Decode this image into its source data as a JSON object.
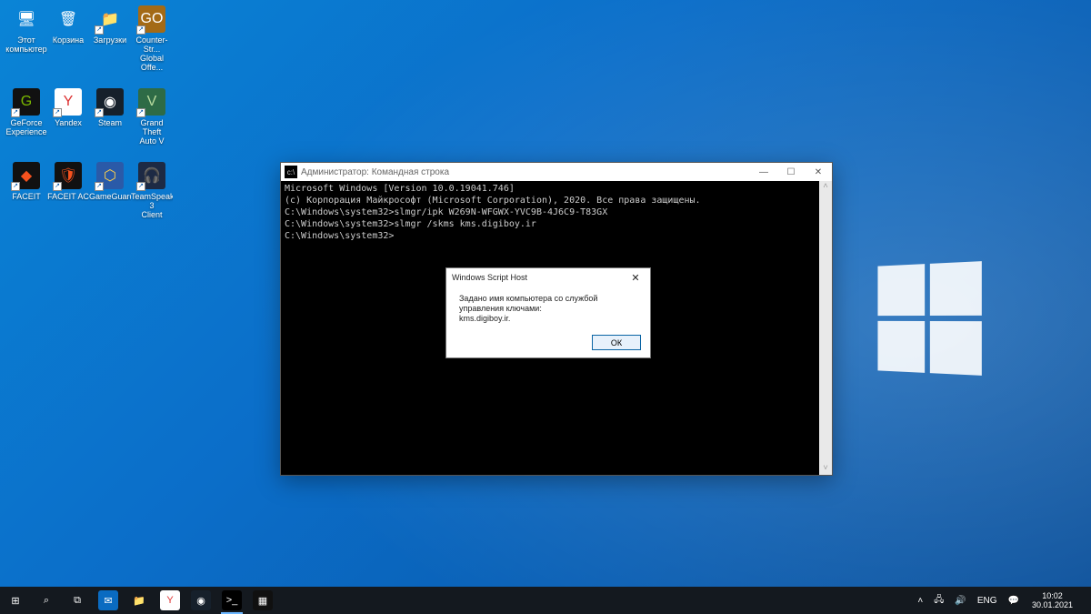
{
  "desktop_icons": [
    {
      "id": "this-pc",
      "label": "Этот\nкомпьютер",
      "glyph": "🖥",
      "bg": "transparent",
      "shortcut": false
    },
    {
      "id": "recycle",
      "label": "Корзина",
      "glyph": "🗑",
      "bg": "transparent",
      "shortcut": false
    },
    {
      "id": "downloads",
      "label": "Загрузки",
      "glyph": "📁",
      "bg": "transparent",
      "shortcut": true
    },
    {
      "id": "csgo",
      "label": "Counter-Str...\nGlobal Offe...",
      "glyph": "GO",
      "bg": "#a36a16",
      "shortcut": true
    },
    {
      "id": "geforce",
      "label": "GeForce\nExperience",
      "glyph": "G",
      "bg": "#111",
      "fg": "#7ab800",
      "shortcut": true
    },
    {
      "id": "yandex",
      "label": "Yandex",
      "glyph": "Y",
      "bg": "#fff",
      "fg": "#d33",
      "shortcut": true
    },
    {
      "id": "steam",
      "label": "Steam",
      "glyph": "◉",
      "bg": "#16202b",
      "fg": "#fff",
      "shortcut": true
    },
    {
      "id": "gtav",
      "label": "Grand Theft\nAuto V",
      "glyph": "V",
      "bg": "#2e6b46",
      "fg": "#b8db9e",
      "shortcut": true
    },
    {
      "id": "faceit",
      "label": "FACEIT",
      "glyph": "◆",
      "bg": "#111",
      "fg": "#f6521e",
      "shortcut": true
    },
    {
      "id": "faceit-ac",
      "label": "FACEIT AC",
      "glyph": "🛡",
      "bg": "#111",
      "fg": "#f6521e",
      "shortcut": true
    },
    {
      "id": "gameguard",
      "label": "GameGuard",
      "glyph": "⬡",
      "bg": "#2a5aa8",
      "fg": "#ffd24a",
      "shortcut": true
    },
    {
      "id": "teamspeak",
      "label": "TeamSpeak 3\nClient",
      "glyph": "🎧",
      "bg": "#1d2a44",
      "fg": "#cfd8e6",
      "shortcut": true
    }
  ],
  "cmd": {
    "title": "Администратор: Командная строка",
    "lines": [
      "Microsoft Windows [Version 10.0.19041.746]",
      "(c) Корпорация Майкрософт (Microsoft Corporation), 2020. Все права защищены.",
      "",
      "C:\\Windows\\system32>slmgr/ipk W269N-WFGWX-YVC9B-4J6C9-T83GX",
      "",
      "C:\\Windows\\system32>slmgr /skms kms.digiboy.ir",
      "",
      "C:\\Windows\\system32>"
    ]
  },
  "dialog": {
    "title": "Windows Script Host",
    "body_line1": "Задано имя компьютера со службой управления ключами:",
    "body_line2": "kms.digiboy.ir.",
    "ok_label": "ОК"
  },
  "taskbar": {
    "items": [
      {
        "id": "start",
        "glyph": "⊞",
        "active": false
      },
      {
        "id": "search",
        "glyph": "⌕",
        "active": false
      },
      {
        "id": "taskview",
        "glyph": "⧉",
        "active": false
      },
      {
        "id": "mail",
        "glyph": "✉",
        "active": false,
        "bg": "#0a6bc1"
      },
      {
        "id": "explorer",
        "glyph": "📁",
        "active": false
      },
      {
        "id": "yandex",
        "glyph": "Y",
        "active": false,
        "bg": "#fff",
        "fg": "#d33"
      },
      {
        "id": "steam",
        "glyph": "◉",
        "active": false,
        "bg": "#16202b"
      },
      {
        "id": "cmd",
        "glyph": ">_",
        "active": true,
        "bg": "#000"
      },
      {
        "id": "app",
        "glyph": "▦",
        "active": false,
        "bg": "#101010"
      }
    ],
    "tray": {
      "chevron": "˄",
      "network": "🖧",
      "sound": "🔊",
      "lang": "ENG",
      "notify": "💬",
      "time": "10:02",
      "date": "30.01.2021"
    }
  }
}
